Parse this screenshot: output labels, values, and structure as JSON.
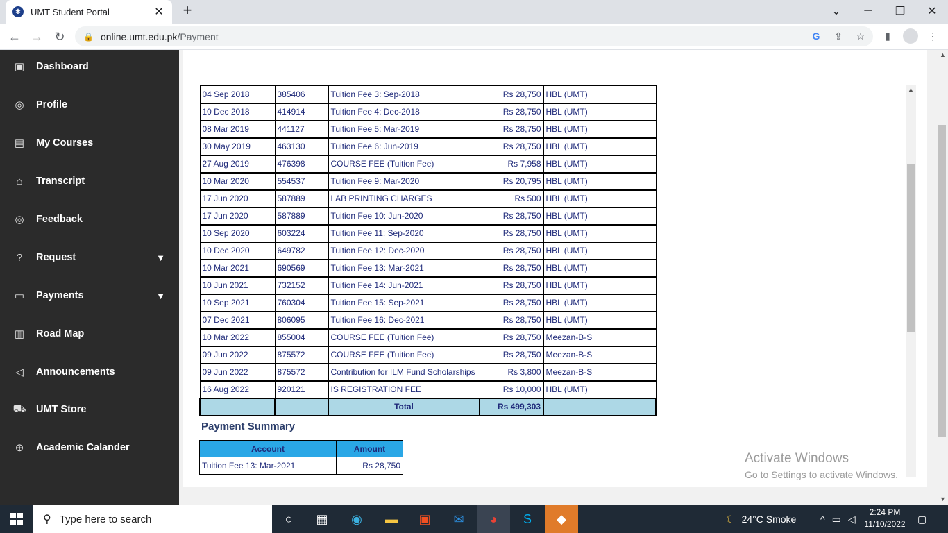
{
  "browser": {
    "tab_title": "UMT Student Portal",
    "url_host": "online.umt.edu.pk",
    "url_path": "/Payment"
  },
  "sidebar": {
    "items": [
      {
        "label": "Dashboard",
        "icon": "dashboard-icon"
      },
      {
        "label": "Profile",
        "icon": "profile-icon"
      },
      {
        "label": "My Courses",
        "icon": "book-icon"
      },
      {
        "label": "Transcript",
        "icon": "graduation-cap-icon"
      },
      {
        "label": "Feedback",
        "icon": "feedback-icon"
      },
      {
        "label": "Request",
        "icon": "question-icon",
        "has_dropdown": true
      },
      {
        "label": "Payments",
        "icon": "money-icon",
        "has_dropdown": true
      },
      {
        "label": "Road Map",
        "icon": "map-icon"
      },
      {
        "label": "Announcements",
        "icon": "megaphone-icon"
      },
      {
        "label": "UMT Store",
        "icon": "cart-icon"
      },
      {
        "label": "Academic Calander",
        "icon": "globe-icon"
      }
    ]
  },
  "fees": {
    "rows": [
      [
        "04 Sep 2018",
        "385406",
        "Tuition Fee 3: Sep-2018",
        "Rs 28,750",
        "HBL (UMT)"
      ],
      [
        "10 Dec 2018",
        "414914",
        "Tuition Fee 4: Dec-2018",
        "Rs 28,750",
        "HBL (UMT)"
      ],
      [
        "08 Mar 2019",
        "441127",
        "Tuition Fee 5: Mar-2019",
        "Rs 28,750",
        "HBL (UMT)"
      ],
      [
        "30 May 2019",
        "463130",
        "Tuition Fee 6: Jun-2019",
        "Rs 28,750",
        "HBL (UMT)"
      ],
      [
        "27 Aug 2019",
        "476398",
        "COURSE FEE (Tuition Fee)",
        "Rs 7,958",
        "HBL (UMT)"
      ],
      [
        "10 Mar 2020",
        "554537",
        "Tuition Fee 9: Mar-2020",
        "Rs 20,795",
        "HBL (UMT)"
      ],
      [
        "17 Jun 2020",
        "587889",
        "LAB PRINTING CHARGES",
        "Rs 500",
        "HBL (UMT)"
      ],
      [
        "17 Jun 2020",
        "587889",
        "Tuition Fee 10: Jun-2020",
        "Rs 28,750",
        "HBL (UMT)"
      ],
      [
        "10 Sep 2020",
        "603224",
        "Tuition Fee 11: Sep-2020",
        "Rs 28,750",
        "HBL (UMT)"
      ],
      [
        "10 Dec 2020",
        "649782",
        "Tuition Fee 12: Dec-2020",
        "Rs 28,750",
        "HBL (UMT)"
      ],
      [
        "10 Mar 2021",
        "690569",
        "Tuition Fee 13: Mar-2021",
        "Rs 28,750",
        "HBL (UMT)"
      ],
      [
        "10 Jun 2021",
        "732152",
        "Tuition Fee 14: Jun-2021",
        "Rs 28,750",
        "HBL (UMT)"
      ],
      [
        "10 Sep 2021",
        "760304",
        "Tuition Fee 15: Sep-2021",
        "Rs 28,750",
        "HBL (UMT)"
      ],
      [
        "07 Dec 2021",
        "806095",
        "Tuition Fee 16: Dec-2021",
        "Rs 28,750",
        "HBL (UMT)"
      ],
      [
        "10 Mar 2022",
        "855004",
        "COURSE FEE (Tuition Fee)",
        "Rs 28,750",
        "Meezan-B-S"
      ],
      [
        "09 Jun 2022",
        "875572",
        "COURSE FEE (Tuition Fee)",
        "Rs 28,750",
        "Meezan-B-S"
      ],
      [
        "09 Jun 2022",
        "875572",
        "Contribution for ILM Fund Scholarships",
        "Rs 3,800",
        "Meezan-B-S"
      ],
      [
        "16 Aug 2022",
        "920121",
        "IS REGISTRATION FEE",
        "Rs 10,000",
        "HBL (UMT)"
      ]
    ],
    "total_label": "Total",
    "total_value": "Rs 499,303"
  },
  "summary": {
    "title": "Payment Summary",
    "col_account": "Account",
    "col_amount": "Amount",
    "rows": [
      [
        "Tuition Fee 13: Mar-2021",
        "Rs 28,750"
      ]
    ]
  },
  "watermark": {
    "line1": "Activate Windows",
    "line2": "Go to Settings to activate Windows."
  },
  "taskbar": {
    "search_placeholder": "Type here to search",
    "weather": "24°C  Smoke",
    "time": "2:24 PM",
    "date": "11/10/2022"
  },
  "colors": {
    "sidebar_bg": "#2b2b2b",
    "total_row_bg": "#add8e6",
    "summary_header_bg": "#2aa7e6",
    "table_text": "#1f2a7a"
  }
}
